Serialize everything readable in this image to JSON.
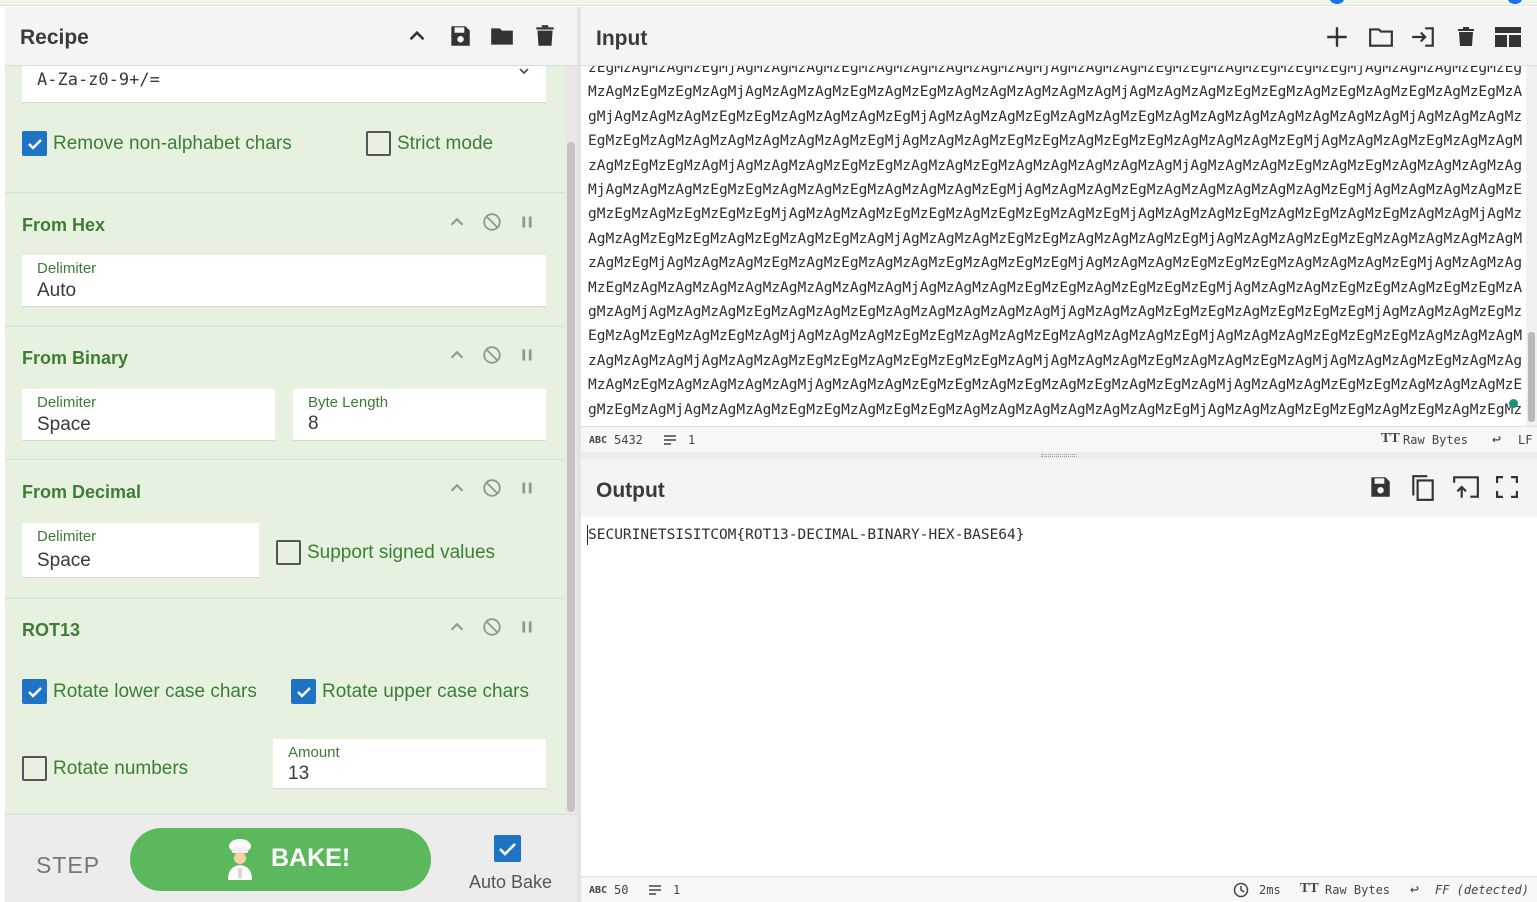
{
  "recipe": {
    "title": "Recipe",
    "alphabet_value": "A-Za-z0-9+/=",
    "remove_non_alpha_label": "Remove non-alphabet chars",
    "remove_non_alpha_checked": true,
    "strict_mode_label": "Strict mode",
    "strict_mode_checked": false,
    "operations": {
      "from_hex": {
        "name": "From Hex",
        "delimiter_label": "Delimiter",
        "delimiter_value": "Auto"
      },
      "from_binary": {
        "name": "From Binary",
        "delimiter_label": "Delimiter",
        "delimiter_value": "Space",
        "byte_length_label": "Byte Length",
        "byte_length_value": "8"
      },
      "from_decimal": {
        "name": "From Decimal",
        "delimiter_label": "Delimiter",
        "delimiter_value": "Space",
        "signed_label": "Support signed values",
        "signed_checked": false
      },
      "rot13": {
        "name": "ROT13",
        "lower_label": "Rotate lower case chars",
        "lower_checked": true,
        "upper_label": "Rotate upper case chars",
        "upper_checked": true,
        "numbers_label": "Rotate numbers",
        "numbers_checked": false,
        "amount_label": "Amount",
        "amount_value": "13"
      }
    },
    "controls": {
      "step_label": "STEP",
      "bake_label": "BAKE!",
      "auto_bake_label": "Auto Bake",
      "auto_bake_checked": true
    }
  },
  "input": {
    "title": "Input",
    "text": "zEgMzAgMzAgMzEgMjAgMzAgMzAgMzEgMzAgMzAgMzAgMzAgMzAgMjAgMzAgMzAgMzEgMzEgMzAgMzEgMzEgMzEgMjAgMzAgMzAgMzEgMzEgMzAgMzEgMzEgMzAgMjAgMzAgMzAgMzEgMzAgMzEgMzAgMzAgMzAgMzAgMzAgMjAgMzAgMzAgMzEgMzEgMzAgMzEgMzAgMzEgMzAgMzEgMzAgMjAgMzAgMzAgMzEgMzEgMzAgMzAgMzAgMzEgMjAgMzAgMzAgMzEgMzAgMzAgMzEgMzAgMzAgMzAgMzAgMzAgMzAgMzAgMjAgMzAgMzAgMzEgMzEgMzAgMzAgMzAgMzAgMzAgMzAgMzEgMjAgMzAgMzAgMzEgMzEgMzAgMzEgMzEgMzAgMzAgMzAgMzEgMjAgMzAgMzAgMzEgMzAgMzAgMzAgMzEgMzEgMzAgMjAgMzAgMzAgMzEgMzEgMzAgMzAgMzEgMzAgMzAgMzAgMzAgMzAgMjAgMzAgMzAgMzEgMzAgMzEgMzAgMzAgMzAgMzAgMjAgMzAgMzAgMzEgMzEgMzAgMzAgMzEgMzAgMzAgMzAgMzEgMjAgMzAgMzAgMzEgMzAgMzAgMzAgMzAgMzAgMzEgMjAgMzAgMzAgMzAgMzEgMzEgMzAgMzEgMzEgMzEgMjAgMzAgMzAgMzEgMzEgMzAgMzEgMzEgMzAgMzEgMjAgMzAgMzAgMzEgMzAgMzEgMzAgMzEgMzAgMzAgMjAgMzAgMzAgMzEgMzEgMzAgMzEgMzAgMzEgMzAgMjAgMzAgMzAgMzEgMzEgMzAgMzAgMzAgMzEgMjAgMzAgMzAgMzEgMzEgMzAgMzAgMzAgMzAgMzAgMzEgMjAgMzAgMzAgMzEgMzAgMzEgMzAgMzAgMzEgMzAgMzEgMzEgMjAgMzAgMzAgMzEgMzEgMzEgMzAgMzAgMzAgMzEgMjAgMzAgMzAgMzEgMzAgMzAgMzAgMzAgMzAgMzAgMzAgMzAgMjAgMzAgMzAgMzEgMzEgMzAgMzEgMzEgMzEgMjAgMzAgMzAgMzEgMzEgMzAgMzEgMzEgMzAgMzAgMjAgMzAgMzAgMzEgMzAgMzAgMzEgMzAgMzAgMzAgMzAgMzAgMjAgMzAgMzAgMzEgMzEgMzAgMzEgMzEgMzEgMjAgMzAgMzAgMzEgMzEgMzAgMzEgMzAgMzEgMzAgMjAgMzAgMzAgMzEgMzEgMzAgMzAgMzEgMzAgMzAgMzAgMzEgMjAgMzAgMzAgMzEgMzEgMzEgMzAgMzAgMzAgMzAgMzAgMzAgMjAgMzAgMzAgMzEgMzEgMzAgMzEgMzEgMzEgMzAgMjAgMzAgMzAgMzEgMzAgMzAgMzEgMzAgMjAgMzAgMzAgMzEgMzAgMzAgMzAgMzEgMzAgMzAgMzAgMzAgMjAgMzAgMzAgMzEgMzEgMzAgMzEgMzAgMzEgMzAgMzEgMzAgMjAgMzAgMzAgMzEgMzEgMzAgMzAgMzAgMzEgMzEgMzAgMjAgMzAgMzAgMzEgMzEgMzAgMzEgMzEgMzAgMzAgMzAgMzAgMzAgMzAgMzEgMjAgMzAgMzAgMzEgMzEgMzAgMzEgMzAgMzEgMzAgMjAgMzAgMzAgMzEgMzEgMzAgMzAgMzAgMzAgMzAgMzAgMzEgMjAgMzAgMzAgMzEgMzAgMzEgMzAgMzEgMjAgMzAgMzAgMzEgMzEgMzAgMzAgMzEgMzAgMzAgMzEgMzEgMjAgMzAgMzAgMzEgMzEgMzAgMzAgMzAgMzAgMzAgMzAgMzAgMjAgMzAgMzAgMzEgMzAgMzAgMzAgMzEgMzAgMzAgMzAgMzAgMzAgMjAgMzAgMzAgMzEgMzEgMzEgMzAgMzAgMzEgMzAgMzEgMjAgMzAgMzAgMzEgMzEgMzAgMzEgMzEgMzAgMzEgMjAgMzAgMzAgMzEgMzAgMzEgMzAgMzAgMzAgMzAgMzAgMjAgMzAgMzAgMzEgMzEgMzAgMzEgMzAgMzEgMzAgMzEgMzAgMjAgMzAgMzAgMzEgMzEgMzAgMzAgMzAgMzEgMzAgMzAgMzEgMzAgMzEgMzAgMzAgMzEgMzAgMzAgMzAgMjAgMzAgMzAgMzEgMzAgMzAgMzAgMzEgMzAgMzAgMzAgMzEgMjAgMzAgMzAgMzEgMzEgMzAgMzEgMzAgMzAgMzAgMzAgMzEgMzEgMzAgMzEgMzEgMjAgMzAgMzAgMzEgMzEgMzAgMzAgMzAgMzEgMzAgMzAgMjAgMzAgMzAgMzEgMzEgMzEgMzAgMzAgMzEgMzAgMzEgMjAgMzAgMzAgMzEgMzEgMzAgMzEgMzEgMzAgMzEgMjAgMzAgMzAgMzEgMzAgMzEgMzAgMzAgMzAgMzEgMzAgMzAgMzAgMzEgMzAgMzAgMzEgMjAgMzAgMzAgMzEgMzAgMzAgMzEgMzEgMzAgMzAgMzAgMzAgMzEgMzAgMzAgMzEgMzAgMzEgMzEgMzAgMzAgMzAgMzAgMzEgMjAgMzAgMzAgMzEgMzEgMzAgMzAgMzAgMzEgMzAgMzAgMzAgMzEgMzAgMzAgMzEgMjAgMzAgMzAgMzEgMzAgMzEgMzAgMzAgMzAgMzAgMzEgMzEgMzAgMzAgMzAgMzEgMzAgMzAgMzAgMzEgMzAgMzAgMzEgMzAgMzAgMzAgMzAgMzEgMzEgMzAgMzAgMzEgMzAgMzAgMzAgMzAgMzEgMzEgMzAgMzAgMzAgMjAgMzAgMzAgMzEgMzEgMzAgMzEgMzEgMzAgMzAgMzAgMzAgMzAgMzAgMzEgMzEgMzAgMzAgMzAgMzEgMzAgMzEgMzAgMzEgMzAgMzEgMzEgMzAgMzAgMzEgMzAgMzAgMzAgMzEgMzAgMzEgMzAgMzEgMjAgMzAgMzAgMzEgMzAgMzAgMzEgMzAgMzAgMzAgMzAgMzEgMzEgMjAgMzAgMzAgMzEgMzAgMzEgMzAgMzAgMzAgMzEgMzAgMzEgMzAgMzAgMzEgMzEgMzAgMzAgMzEgMzEgMzAgMzAgMzAgMzEgMzAgMzEgMjAgMzAgMzAgMzEgMzAgMzAgMzAgMzEgMzAgMzAgMzAgMzAgMzAgMzEgMzAgMzAgMzEgMzAgMzAgMzEgMzAgMzEgMzEgMzAgMzEgMzAgMzEgMzAgMzEgMzEgMzAgMzAgMzEgMzAgMzAgMzEgMzAgMzEgMzEgMzAgMzEgMzAgMzAgMzEgMzAgMzEgMzEgMzAgMzEgMzEgMzAgMzAgMzAgMzAgMzEgMzEgMzAgMzAgMzEgMzEgMzEgMzAgMzAgMzAgMzAgMzEgMzAgMzEgMzEgMzAgMzEgMzEgMzEgMzAgMzAgMzAgMzAgMzEgMzEgMzAgMzAgMzAgMzEgMzAgMzEgMzAgMzAgMzAgMzEgMzEgMzAgMzAgMzEgMzAgMzEgMzAgMzEgMzEgMzEgMzAgMzAgMzAgMzEgMzAgMzEgMzEgMzAgMzAgMzEgMzAgMzEgMzAgMzAgMzAgMzEgMzEgMzAgMzAgMzEgMzAgMzEgMzAgMzEgMzAgMzEgMzEgMzAgMzAgMzEgMzAgMzAgMzAgMzEgMzAgMzEgMzAgMzE",
    "chars_count": "5432",
    "lines_count": "1",
    "encoding": "Raw Bytes",
    "eol": "LF"
  },
  "output": {
    "title": "Output",
    "text": "SECURINETSISITCOM{ROT13-DECIMAL-BINARY-HEX-BASE64}",
    "chars_count": "50",
    "lines_count": "1",
    "time": "2ms",
    "encoding": "Raw Bytes",
    "eol": "FF (detected)"
  },
  "colors": {
    "accent_green": "#5cb85c",
    "op_title": "#3f7d35",
    "checkbox_blue": "#1e73c5",
    "recipe_bg": "#e6f2df"
  }
}
